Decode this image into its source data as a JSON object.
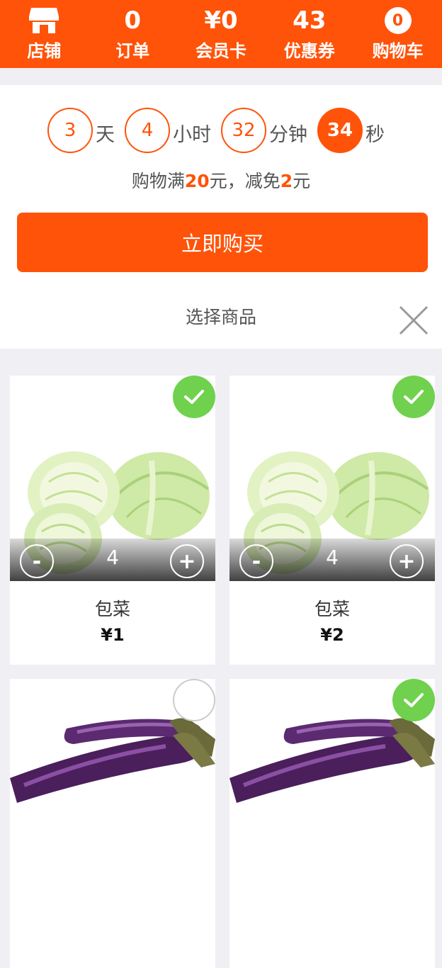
{
  "nav": {
    "store_label": "店铺",
    "orders_count": "0",
    "orders_label": "订单",
    "member_value": "¥0",
    "member_label": "会员卡",
    "coupons_count": "43",
    "coupons_label": "优惠券",
    "cart_count": "0",
    "cart_label": "购物车"
  },
  "countdown": {
    "days": "3",
    "days_unit": "天",
    "hours": "4",
    "hours_unit": "小时",
    "minutes": "32",
    "minutes_unit": "分钟",
    "seconds": "34",
    "seconds_unit": "秒"
  },
  "promo": {
    "prefix": "购物满",
    "threshold": "20",
    "middle": "元，减免",
    "discount": "2",
    "suffix": "元"
  },
  "buy_button": "立即购买",
  "select_title": "选择商品",
  "products": [
    {
      "name": "包菜",
      "price": "¥1",
      "qty": "4",
      "selected": true,
      "image": "cabbage"
    },
    {
      "name": "包菜",
      "price": "¥2",
      "qty": "4",
      "selected": true,
      "image": "cabbage"
    },
    {
      "name": "",
      "price": "",
      "qty": "",
      "selected": false,
      "image": "eggplant"
    },
    {
      "name": "",
      "price": "",
      "qty": "",
      "selected": true,
      "image": "eggplant"
    }
  ],
  "colors": {
    "accent": "#ff5309",
    "check": "#6fd14d"
  }
}
